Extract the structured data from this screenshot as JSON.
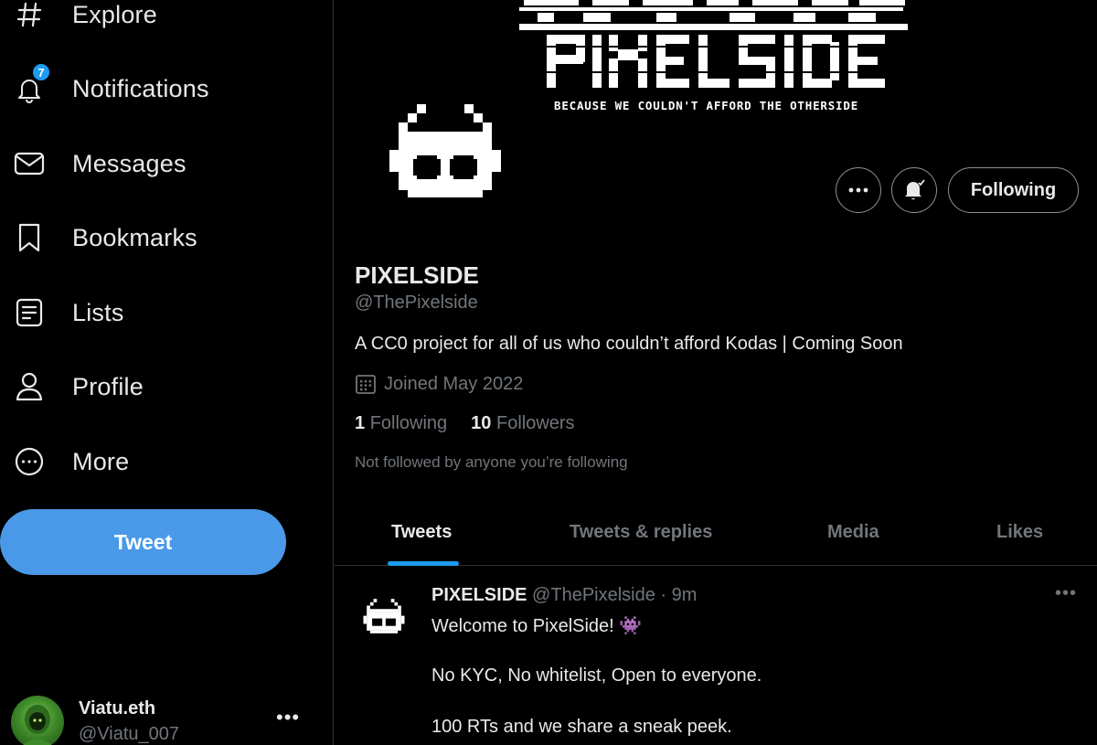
{
  "sidebar": {
    "nav": [
      {
        "label": "Explore",
        "icon": "hashtag-icon"
      },
      {
        "label": "Notifications",
        "icon": "bell-icon",
        "badge": "7"
      },
      {
        "label": "Messages",
        "icon": "envelope-icon"
      },
      {
        "label": "Bookmarks",
        "icon": "bookmark-icon"
      },
      {
        "label": "Lists",
        "icon": "list-icon"
      },
      {
        "label": "Profile",
        "icon": "person-icon"
      },
      {
        "label": "More",
        "icon": "more-circle-icon"
      }
    ],
    "tweet_button": "Tweet",
    "account": {
      "name": "Viatu.eth",
      "handle": "@Viatu_007",
      "more": "•••"
    }
  },
  "profile": {
    "banner_tagline": "BECAUSE WE COULDN'T AFFORD THE OTHERSIDE",
    "banner_logo_text": "PIXELSIDE",
    "following_button": "Following",
    "display_name": "PIXELSIDE",
    "handle": "@ThePixelside",
    "bio": "A CC0 project for all of us who couldn’t afford Kodas | Coming Soon",
    "joined": "Joined May 2022",
    "following_count": "1",
    "following_label": "Following",
    "followers_count": "10",
    "followers_label": "Followers",
    "not_followed": "Not followed by anyone you’re following"
  },
  "tabs": [
    {
      "label": "Tweets",
      "active": true
    },
    {
      "label": "Tweets & replies",
      "active": false
    },
    {
      "label": "Media",
      "active": false
    },
    {
      "label": "Likes",
      "active": false
    }
  ],
  "tweet": {
    "name": "PIXELSIDE",
    "meta": "@ThePixelside · 9m",
    "more": "•••",
    "lines": [
      "Welcome to PixelSide! 👾",
      "No KYC, No whitelist, Open to everyone.",
      "100 RTs and we share a sneak peek."
    ]
  },
  "colors": {
    "accent": "#1d9bf0",
    "tweet_button": "#4a99e9",
    "muted_text": "#71767b",
    "background": "#000000"
  }
}
